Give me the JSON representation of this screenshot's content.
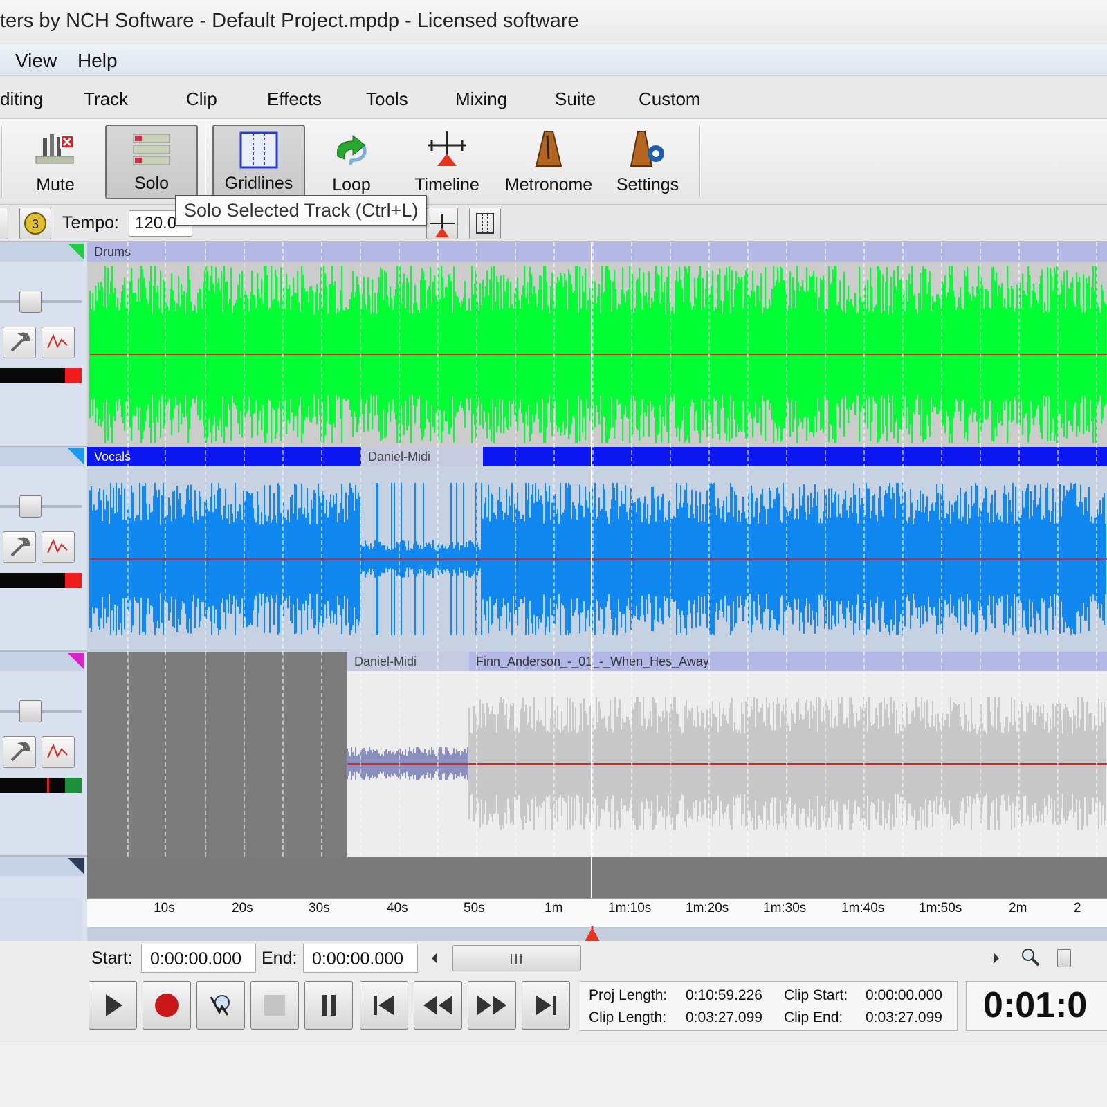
{
  "window": {
    "title": "ters by NCH Software - Default Project.mpdp - Licensed software"
  },
  "menu": {
    "items": [
      "View",
      "Help"
    ]
  },
  "tabs": [
    "diting",
    "Track",
    "Clip",
    "Effects",
    "Tools",
    "Mixing",
    "Suite",
    "Custom"
  ],
  "ribbon": {
    "mute": "Mute",
    "solo": "Solo",
    "gridlines": "Gridlines",
    "loop": "Loop",
    "timeline": "Timeline",
    "metronome": "Metronome",
    "settings": "Settings"
  },
  "tooltip": "Solo Selected Track (Ctrl+L)",
  "tempo": {
    "label": "Tempo:",
    "value": "120.0"
  },
  "tracks": [
    {
      "clip_name": "Drums",
      "color": "#00ff33",
      "header_color": "#b3b8e6"
    },
    {
      "clip_name": "Vocals",
      "color": "#1187f0",
      "header_color": "#0a17f0",
      "midi_clip": "Daniel-Midi"
    },
    {
      "midi_clip": "Daniel-Midi",
      "audio_clip": "Finn_Anderson_-_01_-_When_Hes_Away",
      "color": "#c8c8c8",
      "header_color": "#b3b8e6"
    }
  ],
  "ruler": {
    "ticks": [
      "10s",
      "20s",
      "30s",
      "40s",
      "50s",
      "1m",
      "1m:10s",
      "1m:20s",
      "1m:30s",
      "1m:40s",
      "1m:50s",
      "2m",
      "2"
    ]
  },
  "selection": {
    "start_label": "Start:",
    "start": "0:00:00.000",
    "end_label": "End:",
    "end": "0:00:00.000"
  },
  "info": {
    "proj_length_label": "Proj Length:",
    "proj_length": "0:10:59.226",
    "clip_length_label": "Clip Length:",
    "clip_length": "0:03:27.099",
    "clip_start_label": "Clip Start:",
    "clip_start": "0:00:00.000",
    "clip_end_label": "Clip End:",
    "clip_end": "0:03:27.099"
  },
  "clock": "0:01:0",
  "icons": [
    "mute-icon",
    "solo-icon",
    "gridlines-icon",
    "loop-icon",
    "timeline-icon",
    "metronome-icon",
    "settings-icon",
    "play-icon",
    "record-icon",
    "scrub-icon",
    "stop-icon",
    "pause-icon",
    "skip-start-icon",
    "rewind-icon",
    "fast-forward-icon",
    "skip-end-icon",
    "zoom-icon"
  ]
}
